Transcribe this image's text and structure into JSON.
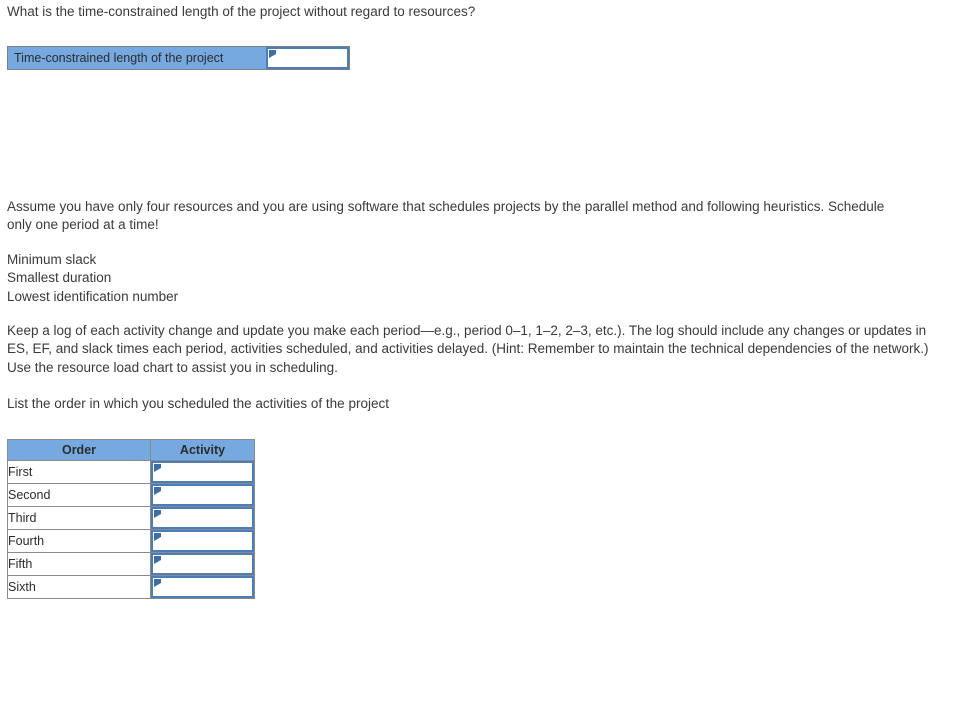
{
  "question": {
    "prompt": "What is the time-constrained length of the project without regard to resources?"
  },
  "answer_bar": {
    "label": "Time-constrained length of the project",
    "value": "",
    "placeholder": ""
  },
  "body": {
    "assume_paragraph": "Assume you have only four resources and you are using software that schedules projects by the parallel method and following heuristics. Schedule only one period at a time!",
    "heuristics": [
      "Minimum slack",
      "Smallest duration",
      "Lowest identification number"
    ],
    "log_paragraph": "Keep a log of each activity change and update you make each period—e.g., period 0–1, 1–2, 2–3, etc.). The log should include any changes or updates in ES, EF, and slack times each period, activities scheduled, and activities delayed. (Hint: Remember to maintain the technical dependencies of the network.) Use the resource load chart to assist you in scheduling.",
    "list_instruction": "List the order in which you scheduled the activities of the project"
  },
  "order_table": {
    "headers": [
      "Order",
      "Activity"
    ],
    "rows": [
      {
        "order": "First",
        "activity": ""
      },
      {
        "order": "Second",
        "activity": ""
      },
      {
        "order": "Third",
        "activity": ""
      },
      {
        "order": "Fourth",
        "activity": ""
      },
      {
        "order": "Fifth",
        "activity": ""
      },
      {
        "order": "Sixth",
        "activity": ""
      }
    ]
  },
  "colors": {
    "header_blue": "#76a9e0",
    "input_border_blue": "#4a7ebb",
    "marker_blue": "#3b6ea8",
    "table_border_gray": "#8a8a8a",
    "text": "#3a3a3a"
  }
}
